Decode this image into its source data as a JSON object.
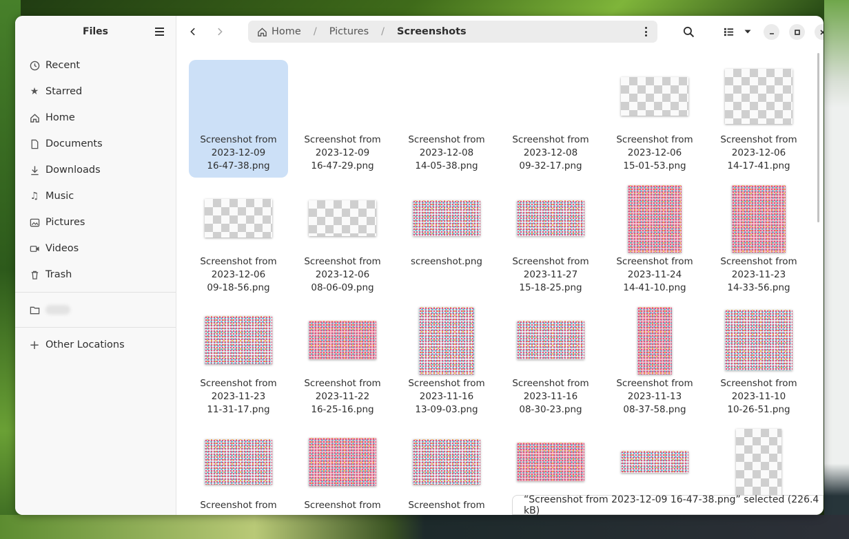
{
  "sidebar": {
    "title": "Files",
    "items": [
      {
        "label": "Recent",
        "icon": "clock-icon"
      },
      {
        "label": "Starred",
        "icon": "star-icon"
      },
      {
        "label": "Home",
        "icon": "home-icon"
      },
      {
        "label": "Documents",
        "icon": "document-icon"
      },
      {
        "label": "Downloads",
        "icon": "download-icon"
      },
      {
        "label": "Music",
        "icon": "music-icon"
      },
      {
        "label": "Pictures",
        "icon": "image-icon"
      },
      {
        "label": "Videos",
        "icon": "video-icon"
      },
      {
        "label": "Trash",
        "icon": "trash-icon"
      }
    ],
    "other_locations": "Other Locations"
  },
  "path": {
    "home": "Home",
    "sep1": "/",
    "pictures": "Pictures",
    "sep2": "/",
    "current": "Screenshots"
  },
  "files": [
    {
      "l1": "Screenshot from",
      "l2": "2023-12-09",
      "l3": "16-47-38.png",
      "selected": true
    },
    {
      "l1": "Screenshot from",
      "l2": "2023-12-09",
      "l3": "16-47-29.png"
    },
    {
      "l1": "Screenshot from",
      "l2": "2023-12-08",
      "l3": "14-05-38.png"
    },
    {
      "l1": "Screenshot from",
      "l2": "2023-12-08",
      "l3": "09-32-17.png"
    },
    {
      "l1": "Screenshot from",
      "l2": "2023-12-06",
      "l3": "15-01-53.png"
    },
    {
      "l1": "Screenshot from",
      "l2": "2023-12-06",
      "l3": "14-17-41.png"
    },
    {
      "l1": "Screenshot from",
      "l2": "2023-12-06",
      "l3": "09-18-56.png"
    },
    {
      "l1": "Screenshot from",
      "l2": "2023-12-06",
      "l3": "08-06-09.png"
    },
    {
      "l1": "screenshot.png",
      "l2": "",
      "l3": ""
    },
    {
      "l1": "Screenshot from",
      "l2": "2023-11-27",
      "l3": "15-18-25.png"
    },
    {
      "l1": "Screenshot from",
      "l2": "2023-11-24",
      "l3": "14-41-10.png"
    },
    {
      "l1": "Screenshot from",
      "l2": "2023-11-23",
      "l3": "14-33-56.png"
    },
    {
      "l1": "Screenshot from",
      "l2": "2023-11-23",
      "l3": "11-31-17.png"
    },
    {
      "l1": "Screenshot from",
      "l2": "2023-11-22",
      "l3": "16-25-16.png"
    },
    {
      "l1": "Screenshot from",
      "l2": "2023-11-16",
      "l3": "13-09-03.png"
    },
    {
      "l1": "Screenshot from",
      "l2": "2023-11-16",
      "l3": "08-30-23.png"
    },
    {
      "l1": "Screenshot from",
      "l2": "2023-11-13",
      "l3": "08-37-58.png"
    },
    {
      "l1": "Screenshot from",
      "l2": "2023-11-10",
      "l3": "10-26-51.png"
    },
    {
      "l1": "Screenshot from",
      "l2": "",
      "l3": ""
    },
    {
      "l1": "Screenshot from",
      "l2": "",
      "l3": ""
    },
    {
      "l1": "Screenshot from",
      "l2": "",
      "l3": ""
    },
    {
      "l1": "",
      "l2": "",
      "l3": ""
    },
    {
      "l1": "",
      "l2": "",
      "l3": ""
    },
    {
      "l1": "",
      "l2": "",
      "l3": ""
    }
  ],
  "status": {
    "text": "“Screenshot from 2023-12-09 16-47-38.png” selected  (226.4 kB)"
  },
  "colors": {
    "selection": "#cce0f7",
    "sidebar_bg": "#f8f8f8"
  }
}
